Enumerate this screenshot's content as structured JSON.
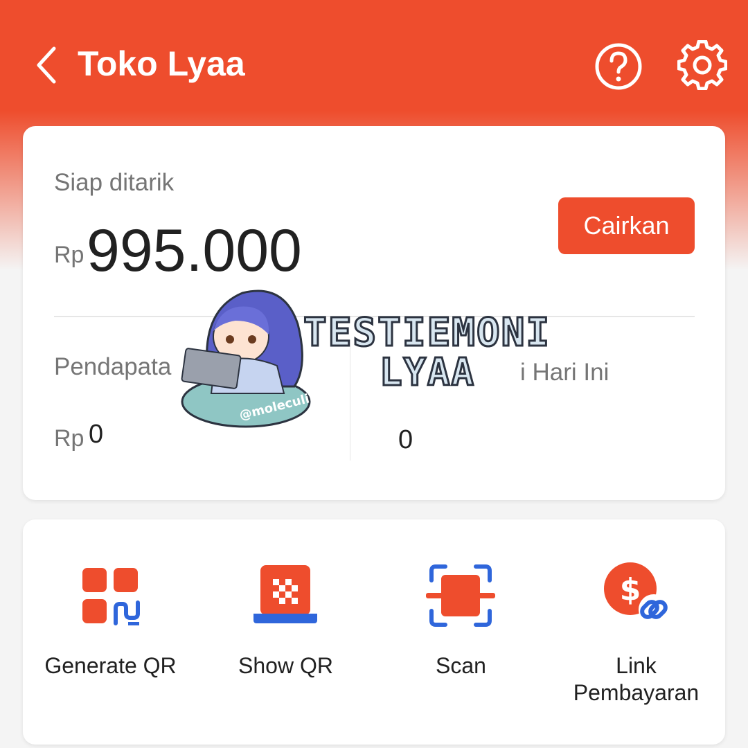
{
  "header": {
    "title": "Toko Lyaa",
    "back_icon": "chevron-left-icon",
    "help_icon": "help-circle-icon",
    "settings_icon": "gear-icon",
    "brand_color": "#ee4d2d"
  },
  "balance": {
    "ready_label": "Siap ditarik",
    "currency": "Rp",
    "amount": "995.000",
    "cashout_label": "Cairkan"
  },
  "stats": {
    "income_label": "Pendapata",
    "income_currency": "Rp",
    "income_value": "0",
    "transactions_label": "i Hari Ini",
    "transactions_value": "0"
  },
  "watermark": {
    "line1": "TESTIEMONI",
    "line2": "LYAA",
    "handle": "@moleculi"
  },
  "menu": {
    "items": [
      {
        "label": "Generate QR",
        "icon": "generate-qr-icon"
      },
      {
        "label": "Show QR",
        "icon": "show-qr-icon"
      },
      {
        "label": "Scan",
        "icon": "scan-icon"
      },
      {
        "label": "Link\nPembayaran",
        "icon": "payment-link-icon"
      }
    ]
  }
}
